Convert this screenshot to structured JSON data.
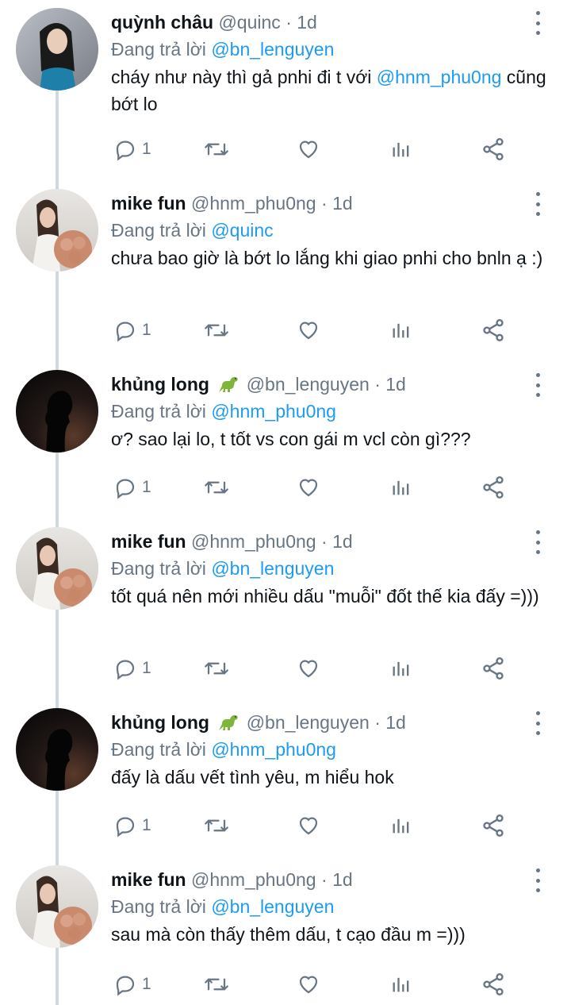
{
  "reply_prefix": "Đang trả lời",
  "tweets": [
    {
      "name": "quỳnh châu",
      "handle": "@quinc",
      "separator": "·",
      "time": "1d",
      "reply_to": "@bn_lenguyen",
      "text_before": "cháy như này thì gả pnhi đi t với ",
      "text_mention": "@hnm_phu0ng",
      "text_after": " cũng bớt lo",
      "reply_count": "1",
      "avatar": "avatar-quynh-chau"
    },
    {
      "name": "mike fun",
      "handle": "@hnm_phu0ng",
      "separator": "·",
      "time": "1d",
      "reply_to": "@quinc",
      "text_before": "chưa bao giờ là bớt lo lắng khi giao pnhi cho bnln ạ :)",
      "text_mention": "",
      "text_after": "",
      "reply_count": "1",
      "avatar": "avatar-mike-fun"
    },
    {
      "name": "khủng long",
      "handle": "@bn_lenguyen",
      "separator": "·",
      "time": "1d",
      "reply_to": "@hnm_phu0ng",
      "text_before": "ơ? sao lại lo, t tốt vs con gái m vcl còn gì???",
      "text_mention": "",
      "text_after": "",
      "reply_count": "1",
      "avatar": "avatar-khung-long"
    },
    {
      "name": "mike fun",
      "handle": "@hnm_phu0ng",
      "separator": "·",
      "time": "1d",
      "reply_to": "@bn_lenguyen",
      "text_before": "tốt quá nên mới nhiều dấu \"muỗi\" đốt thế kia đấy =)))",
      "text_mention": "",
      "text_after": "",
      "reply_count": "1",
      "avatar": "avatar-mike-fun"
    },
    {
      "name": "khủng long",
      "handle": "@bn_lenguyen",
      "separator": "·",
      "time": "1d",
      "reply_to": "@hnm_phu0ng",
      "text_before": "đấy là dấu vết tình yêu, m hiểu hok",
      "text_mention": "",
      "text_after": "",
      "reply_count": "1",
      "avatar": "avatar-khung-long"
    },
    {
      "name": "mike fun",
      "handle": "@hnm_phu0ng",
      "separator": "·",
      "time": "1d",
      "reply_to": "@bn_lenguyen",
      "text_before": "sau mà còn thấy thêm dấu, t cạo đầu m =)))",
      "text_mention": "",
      "text_after": "",
      "reply_count": "1",
      "avatar": "avatar-mike-fun"
    }
  ],
  "colors": {
    "link": "#1d9bf0",
    "secondary": "#687684",
    "text": "#0f1419",
    "thread_line": "#cfd9de"
  },
  "icons": {
    "reply": "reply-icon",
    "retweet": "retweet-icon",
    "like": "heart-icon",
    "views": "analytics-icon",
    "share": "share-icon",
    "more": "more-vertical-icon",
    "dino": "dinosaur-emoji-icon"
  }
}
